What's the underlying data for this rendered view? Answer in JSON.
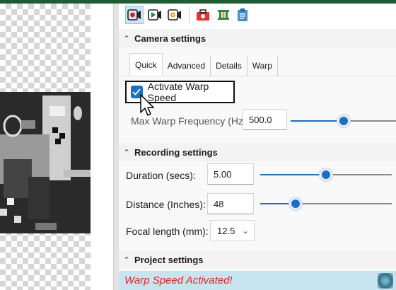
{
  "toolbar": {
    "buttons": [
      {
        "icon": "record-camera-icon",
        "selected": true
      },
      {
        "icon": "play-camera-icon",
        "selected": false
      },
      {
        "icon": "settings-camera-icon",
        "selected": false
      },
      {
        "icon": "toolbox-icon",
        "selected": false
      },
      {
        "icon": "tripod-icon",
        "selected": false
      },
      {
        "icon": "clipboard-icon",
        "selected": false
      }
    ]
  },
  "camera_settings": {
    "title": "Camera settings",
    "tabs": [
      "Quick",
      "Advanced",
      "Details",
      "Warp"
    ],
    "active_tab": "Quick",
    "warp_checkbox": {
      "label": "Activate Warp Speed",
      "checked": true
    },
    "max_warp": {
      "label": "Max Warp Frequency (Hz):",
      "value": "500.0",
      "slider_fraction": 0.5
    }
  },
  "recording_settings": {
    "title": "Recording settings",
    "duration": {
      "label": "Duration (secs):",
      "value": "5.00",
      "slider_fraction": 0.5
    },
    "distance": {
      "label": "Distance (Inches):",
      "value": "48",
      "slider_fraction": 0.27
    },
    "focal_length": {
      "label": "Focal length (mm):",
      "value": "12.5"
    }
  },
  "project_settings": {
    "title": "Project settings"
  },
  "status": {
    "message": "Warp Speed Activated!"
  },
  "colors": {
    "accent": "#1a6fc9",
    "status_bg": "#c7e5ee",
    "status_text": "#e0281f",
    "topbar": "#1e5d34"
  }
}
